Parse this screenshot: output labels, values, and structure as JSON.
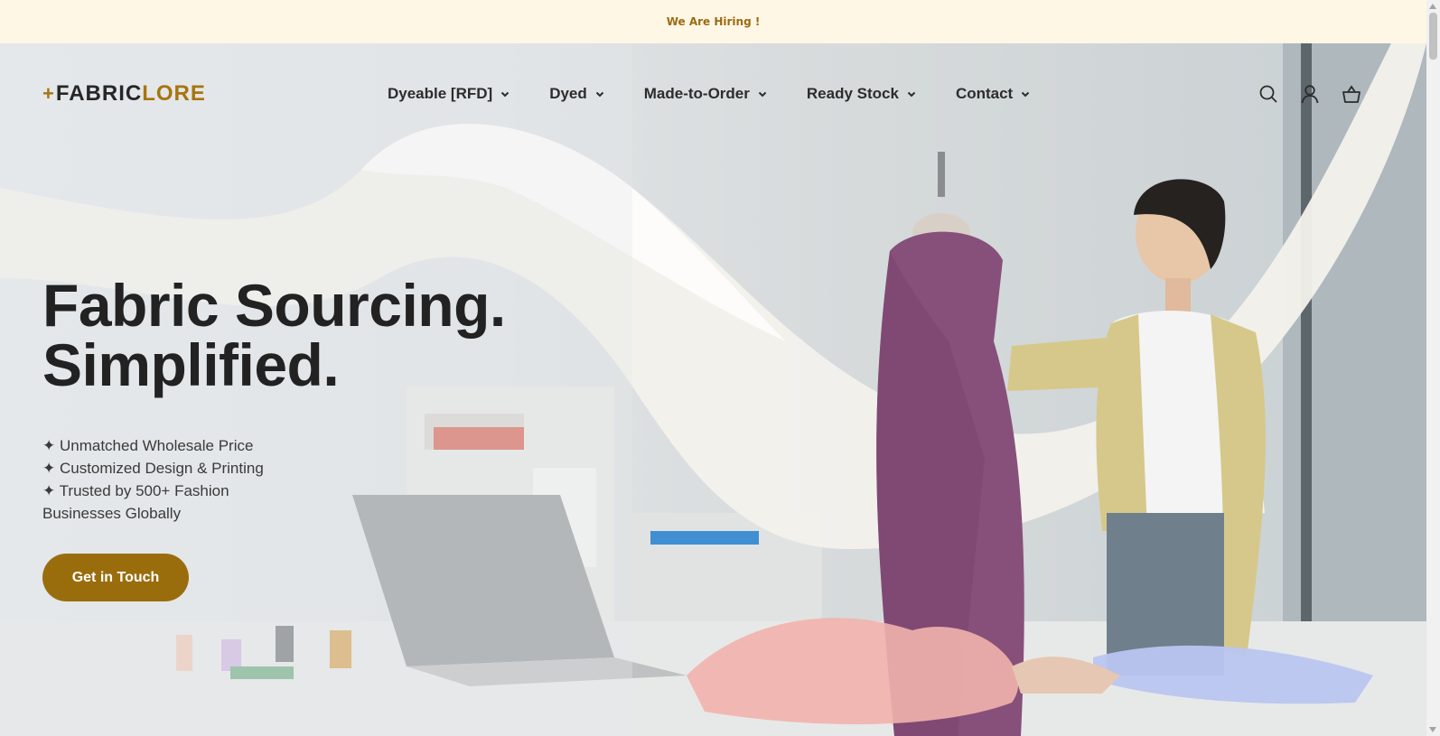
{
  "announcement": {
    "text": "We Are Hiring !"
  },
  "header": {
    "logo_prefix": "FABRIC",
    "logo_suffix": "LORE",
    "nav": [
      {
        "label": "Dyeable [RFD]"
      },
      {
        "label": "Dyed"
      },
      {
        "label": "Made-to-Order"
      },
      {
        "label": "Ready Stock"
      },
      {
        "label": "Contact"
      }
    ],
    "icons": [
      "search-icon",
      "account-icon",
      "cart-icon"
    ]
  },
  "hero": {
    "headline_line1": "Fabric Sourcing.",
    "headline_line2": "Simplified.",
    "features": [
      "✦ Unmatched Wholesale Price",
      "✦ Customized Design & Printing",
      "✦ Trusted by 500+ Fashion Businesses Globally"
    ],
    "cta_label": "Get in Touch"
  },
  "colors": {
    "brand": "#a8740f",
    "cta": "#9a6d0c",
    "announce_bg": "#fff7e6"
  }
}
